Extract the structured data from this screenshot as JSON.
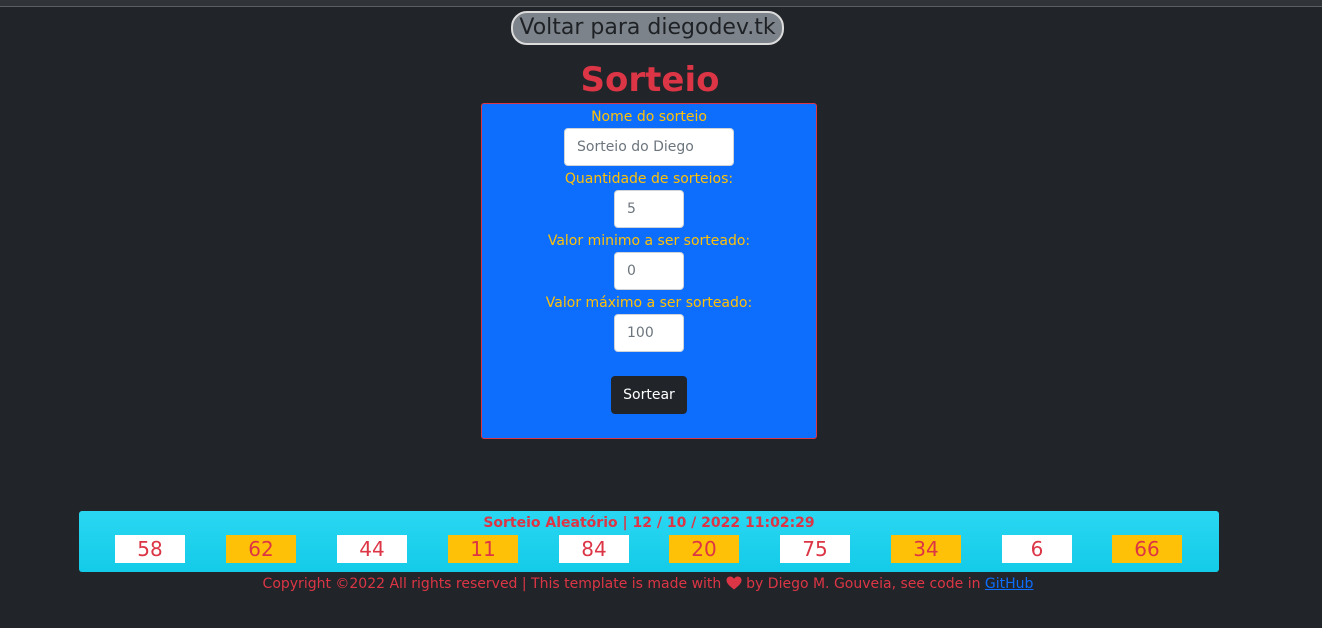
{
  "header": {
    "back_button_label": "Voltar para diegodev.tk",
    "title": "Sorteio"
  },
  "form": {
    "name_label": "Nome do sorteio",
    "name_placeholder": "Sorteio do Diego",
    "quantity_label": "Quantidade de sorteios:",
    "quantity_placeholder": "5",
    "min_label": "Valor minimo a ser sorteado:",
    "min_placeholder": "0",
    "max_label": "Valor máximo a ser sorteado:",
    "max_placeholder": "100",
    "submit_label": "Sortear"
  },
  "result": {
    "title": "Sorteio Aleatório | 12 / 10 / 2022 11:02:29",
    "numbers": [
      "58",
      "62",
      "44",
      "11",
      "84",
      "20",
      "75",
      "34",
      "6",
      "66"
    ]
  },
  "footer": {
    "text_before": "Copyright ©2022 All rights reserved | This template is made with",
    "text_after": "by Diego M. Gouveia, see code in",
    "link_label": "GitHub"
  },
  "icons": {
    "heart": "heart-icon"
  },
  "colors": {
    "background": "#212529",
    "accent_red": "#dc3545",
    "form_blue": "#0d6efd",
    "label_yellow": "#ffc107",
    "result_cyan": "#1ccfea"
  }
}
